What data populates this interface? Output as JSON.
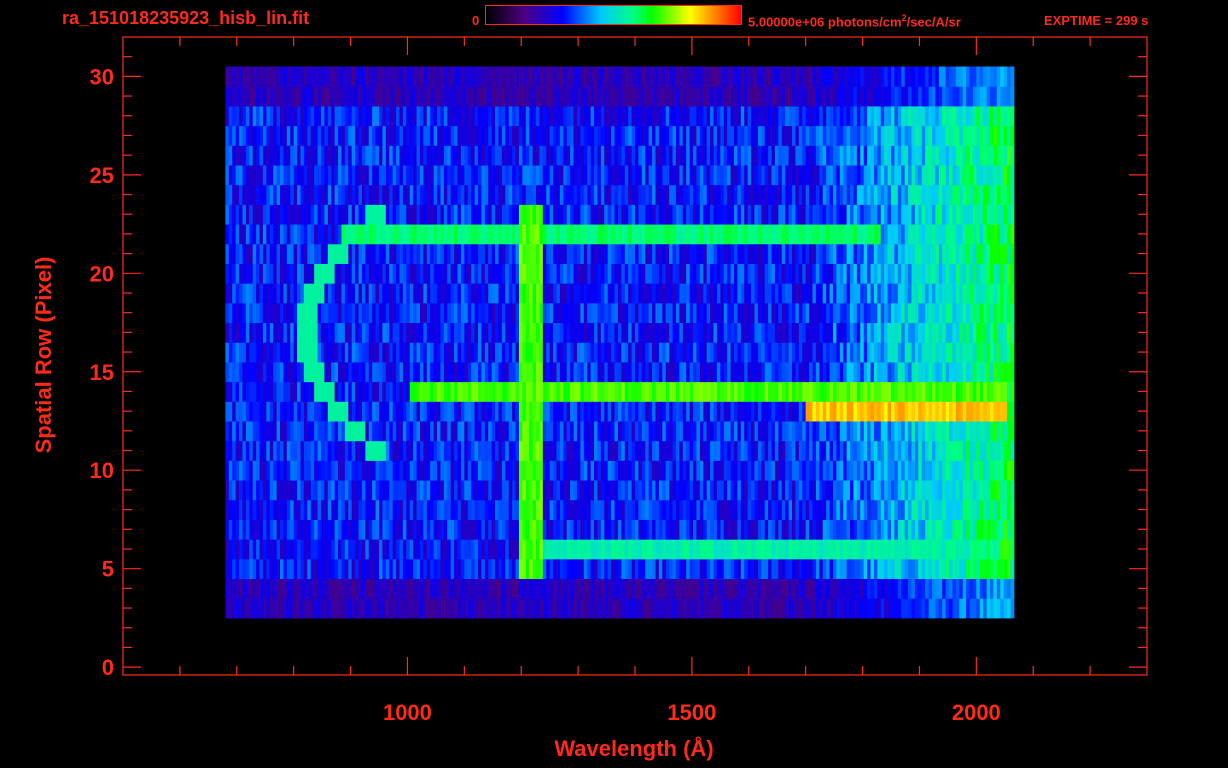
{
  "header": {
    "filename": "ra_151018235923_hisb_lin.fit",
    "colorbar_min": "0",
    "colorbar_max": "5.00000e+06 photons/cm²/sec/A/sr",
    "exptime": "EXPTIME = 299 s"
  },
  "colors": {
    "axis": "#ff2a1a",
    "background": "#000000",
    "colormap": [
      "#000000",
      "#4b0082",
      "#0000ff",
      "#00c8ff",
      "#00ff80",
      "#00ff00",
      "#ffff00",
      "#ff8000",
      "#ff0000"
    ]
  },
  "chart_data": {
    "type": "heatmap",
    "xlabel": "Wavelength (Å)",
    "ylabel": "Spatial Row (Pixel)",
    "xlim": [
      500,
      2300
    ],
    "ylim": [
      -0.4,
      32
    ],
    "xticks": [
      1000,
      1500,
      2000
    ],
    "yticks": [
      0,
      5,
      10,
      15,
      20,
      25,
      30
    ],
    "colorbar_range": [
      0,
      5000000
    ],
    "data_x_range": [
      680,
      2060
    ],
    "data_rows": [
      3,
      30
    ],
    "features": [
      {
        "feature": "bright row",
        "row": 22,
        "x_range": [
          880,
          1830
        ],
        "level": 0.55
      },
      {
        "feature": "bright row",
        "row": 14,
        "x_range": [
          1000,
          2050
        ],
        "level": 0.65
      },
      {
        "feature": "bright row",
        "row": 13,
        "x_range": [
          1700,
          2050
        ],
        "level": 0.8
      },
      {
        "feature": "bright row",
        "row": 6,
        "x_range": [
          1200,
          2050
        ],
        "level": 0.5
      },
      {
        "feature": "bright column",
        "x": 1215,
        "rows": [
          5,
          23
        ],
        "level": 0.65
      },
      {
        "feature": "arc",
        "rows": [
          11,
          23
        ],
        "x_range": [
          800,
          1000
        ],
        "level": 0.55
      }
    ]
  }
}
